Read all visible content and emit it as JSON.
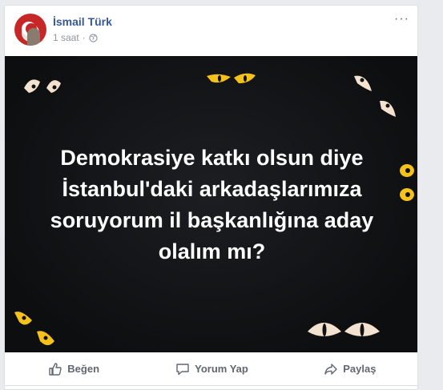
{
  "post": {
    "author": "İsmail Türk",
    "time": "1 saat",
    "privacy_icon": "globe-icon",
    "more_icon": "more-icon",
    "more_glyph": "···",
    "image_text": [
      "Demokrasiye katkı olsun diye",
      "İstanbul'daki arkadaşlarımıza",
      "soruyorum il başkanlığına aday",
      "olalım mı?"
    ],
    "actions": [
      {
        "label": "Beğen",
        "icon": "like-icon"
      },
      {
        "label": "Yorum Yap",
        "icon": "comment-icon"
      },
      {
        "label": "Paylaş",
        "icon": "share-icon"
      }
    ]
  },
  "colors": {
    "page_bg": "#e9ebee",
    "author": "#365899",
    "meta": "#90949c",
    "image_bg": "#131416",
    "eye_yellow": "#f5c21b",
    "eye_white": "#f3e2cf"
  }
}
